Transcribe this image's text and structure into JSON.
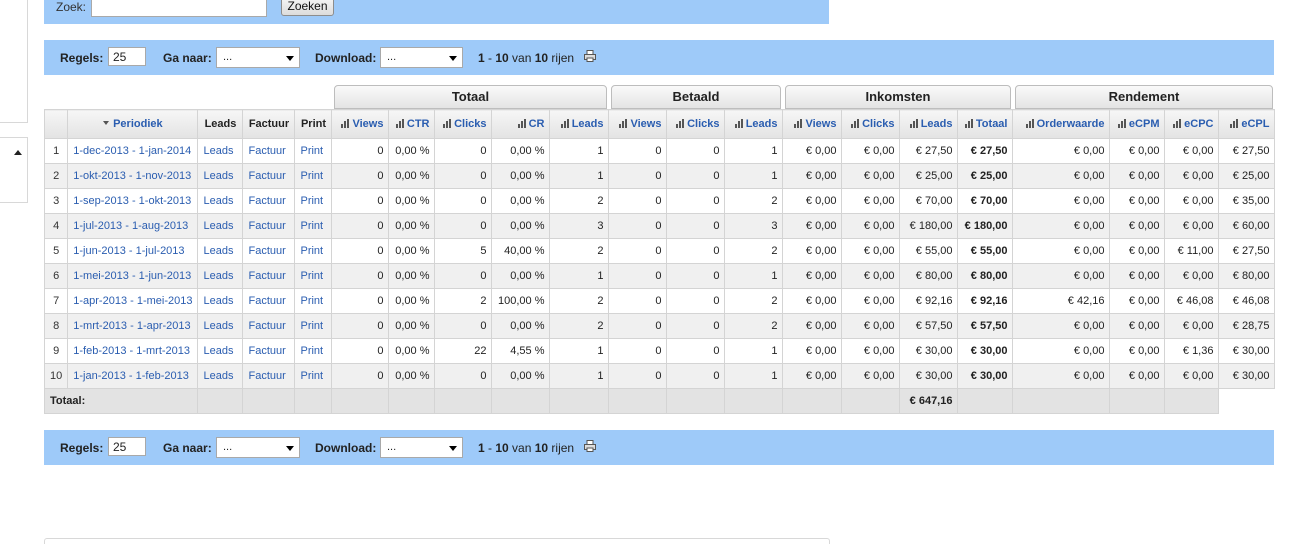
{
  "search": {
    "label": "Zoek:",
    "value": "",
    "button": "Zoeken"
  },
  "pager": {
    "rules_label": "Regels:",
    "rules_value": "25",
    "goto_label": "Ga naar:",
    "goto_value": "...",
    "download_label": "Download:",
    "download_value": "...",
    "range_from": "1",
    "range_sep": " - ",
    "range_to": "10",
    "of_word": " van ",
    "total_rows": "10",
    "rows_word": " rijen"
  },
  "groups": [
    "Totaal",
    "Betaald",
    "Inkomsten",
    "Rendement"
  ],
  "columns": [
    "Periodiek",
    "Leads",
    "Factuur",
    "Print",
    "Views",
    "CTR",
    "Clicks",
    "CR",
    "Leads",
    "Views",
    "Clicks",
    "Leads",
    "Views",
    "Clicks",
    "Leads",
    "Totaal",
    "Orderwaarde",
    "eCPM",
    "eCPC",
    "eCPL"
  ],
  "rows": [
    [
      "1",
      "1-dec-2013 - 1-jan-2014",
      "Leads",
      "Factuur",
      "Print",
      "0",
      "0,00 %",
      "0",
      "0,00 %",
      "1",
      "0",
      "0",
      "1",
      "€ 0,00",
      "€ 0,00",
      "€ 27,50",
      "€ 27,50",
      "€ 0,00",
      "€ 0,00",
      "€ 0,00",
      "€ 27,50"
    ],
    [
      "2",
      "1-okt-2013 - 1-nov-2013",
      "Leads",
      "Factuur",
      "Print",
      "0",
      "0,00 %",
      "0",
      "0,00 %",
      "1",
      "0",
      "0",
      "1",
      "€ 0,00",
      "€ 0,00",
      "€ 25,00",
      "€ 25,00",
      "€ 0,00",
      "€ 0,00",
      "€ 0,00",
      "€ 25,00"
    ],
    [
      "3",
      "1-sep-2013 - 1-okt-2013",
      "Leads",
      "Factuur",
      "Print",
      "0",
      "0,00 %",
      "0",
      "0,00 %",
      "2",
      "0",
      "0",
      "2",
      "€ 0,00",
      "€ 0,00",
      "€ 70,00",
      "€ 70,00",
      "€ 0,00",
      "€ 0,00",
      "€ 0,00",
      "€ 35,00"
    ],
    [
      "4",
      "1-jul-2013 - 1-aug-2013",
      "Leads",
      "Factuur",
      "Print",
      "0",
      "0,00 %",
      "0",
      "0,00 %",
      "3",
      "0",
      "0",
      "3",
      "€ 0,00",
      "€ 0,00",
      "€ 180,00",
      "€ 180,00",
      "€ 0,00",
      "€ 0,00",
      "€ 0,00",
      "€ 60,00"
    ],
    [
      "5",
      "1-jun-2013 - 1-jul-2013",
      "Leads",
      "Factuur",
      "Print",
      "0",
      "0,00 %",
      "5",
      "40,00 %",
      "2",
      "0",
      "0",
      "2",
      "€ 0,00",
      "€ 0,00",
      "€ 55,00",
      "€ 55,00",
      "€ 0,00",
      "€ 0,00",
      "€ 11,00",
      "€ 27,50"
    ],
    [
      "6",
      "1-mei-2013 - 1-jun-2013",
      "Leads",
      "Factuur",
      "Print",
      "0",
      "0,00 %",
      "0",
      "0,00 %",
      "1",
      "0",
      "0",
      "1",
      "€ 0,00",
      "€ 0,00",
      "€ 80,00",
      "€ 80,00",
      "€ 0,00",
      "€ 0,00",
      "€ 0,00",
      "€ 80,00"
    ],
    [
      "7",
      "1-apr-2013 - 1-mei-2013",
      "Leads",
      "Factuur",
      "Print",
      "0",
      "0,00 %",
      "2",
      "100,00 %",
      "2",
      "0",
      "0",
      "2",
      "€ 0,00",
      "€ 0,00",
      "€ 92,16",
      "€ 92,16",
      "€ 42,16",
      "€ 0,00",
      "€ 46,08",
      "€ 46,08"
    ],
    [
      "8",
      "1-mrt-2013 - 1-apr-2013",
      "Leads",
      "Factuur",
      "Print",
      "0",
      "0,00 %",
      "0",
      "0,00 %",
      "2",
      "0",
      "0",
      "2",
      "€ 0,00",
      "€ 0,00",
      "€ 57,50",
      "€ 57,50",
      "€ 0,00",
      "€ 0,00",
      "€ 0,00",
      "€ 28,75"
    ],
    [
      "9",
      "1-feb-2013 - 1-mrt-2013",
      "Leads",
      "Factuur",
      "Print",
      "0",
      "0,00 %",
      "22",
      "4,55 %",
      "1",
      "0",
      "0",
      "1",
      "€ 0,00",
      "€ 0,00",
      "€ 30,00",
      "€ 30,00",
      "€ 0,00",
      "€ 0,00",
      "€ 1,36",
      "€ 30,00"
    ],
    [
      "10",
      "1-jan-2013 - 1-feb-2013",
      "Leads",
      "Factuur",
      "Print",
      "0",
      "0,00 %",
      "0",
      "0,00 %",
      "1",
      "0",
      "0",
      "1",
      "€ 0,00",
      "€ 0,00",
      "€ 30,00",
      "€ 30,00",
      "€ 0,00",
      "€ 0,00",
      "€ 0,00",
      "€ 30,00"
    ]
  ],
  "totals": {
    "label": "Totaal:",
    "totaal": "€ 647,16"
  },
  "icons": {
    "printer": "printer-icon",
    "sort": "sort-desc-icon",
    "bars": "bar-chart-icon",
    "collapse": "collapse-up-icon"
  },
  "colors": {
    "bar": "#9ecaf9",
    "link": "#2a5db0"
  }
}
